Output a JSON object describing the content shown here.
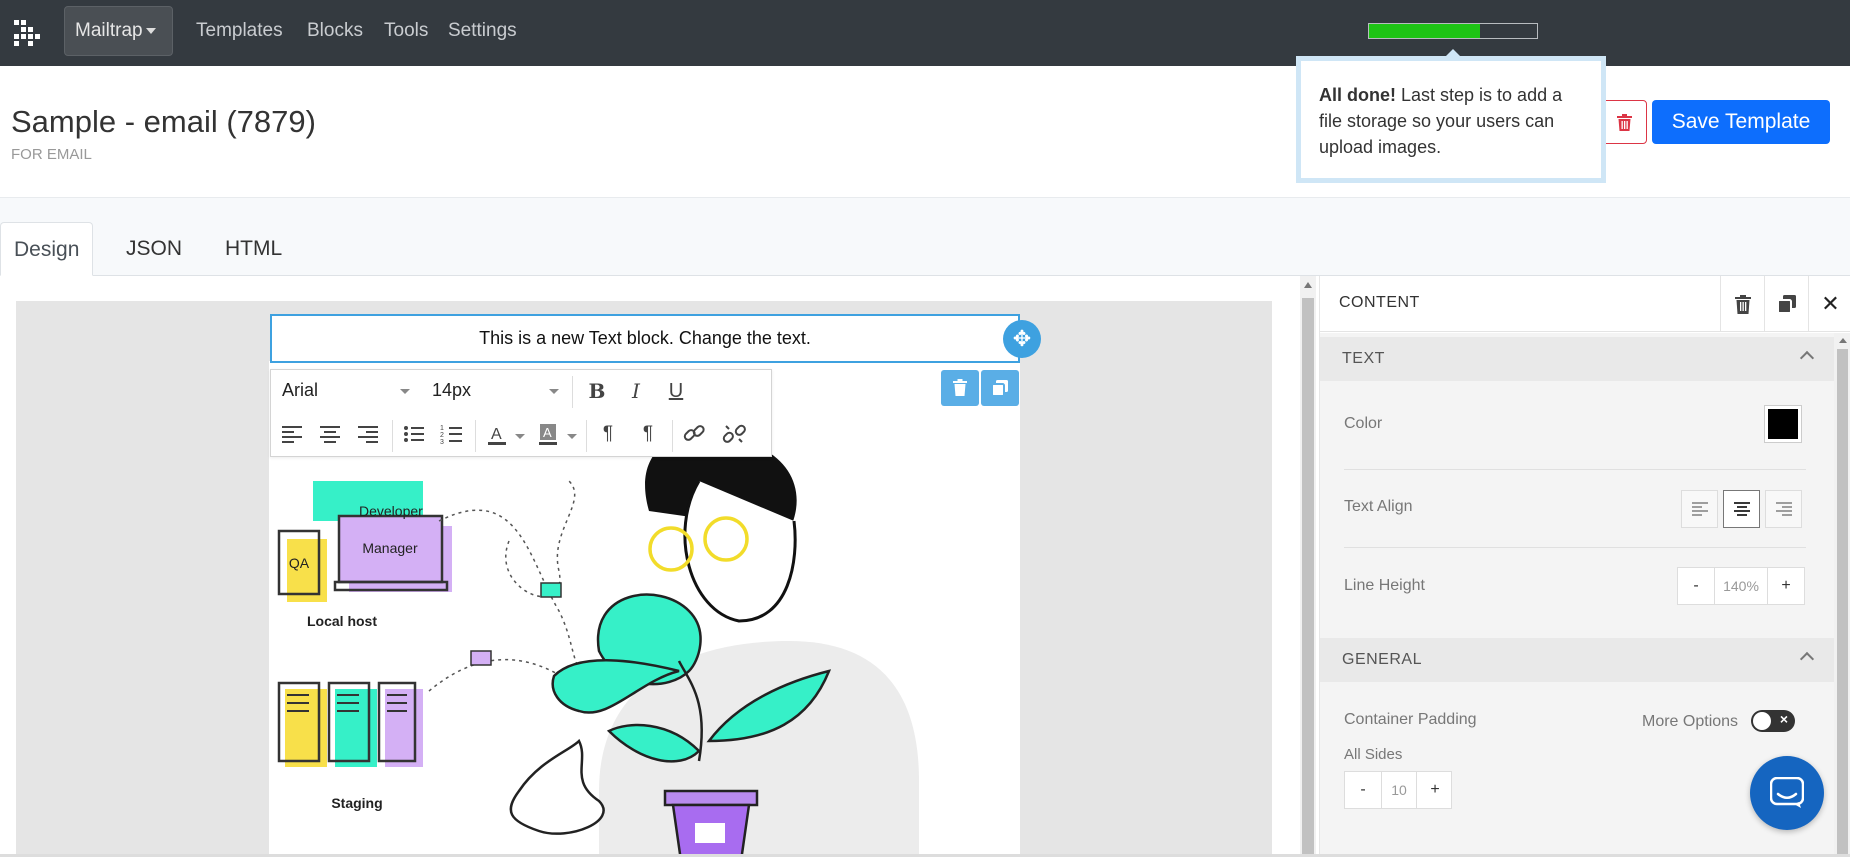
{
  "nav": {
    "brand": "Mailtrap",
    "links": [
      "Templates",
      "Blocks",
      "Tools",
      "Settings"
    ],
    "progress": 0.66
  },
  "header": {
    "title": "Sample - email (7879)",
    "subtitle": "FOR EMAIL",
    "save_label": "Save Template"
  },
  "popover": {
    "bold": "All done!",
    "text": " Last step is to add a file storage so your users can upload images."
  },
  "tabs": [
    "Design",
    "JSON",
    "HTML"
  ],
  "editor": {
    "text_block": "This is a new Text block. Change the text.",
    "font": "Arial",
    "font_size": "14px"
  },
  "illustration": {
    "labels": {
      "developer": "Developer",
      "qa": "QA",
      "manager": "Manager",
      "localhost": "Local host",
      "staging": "Staging"
    }
  },
  "panel": {
    "title": "CONTENT",
    "text_section": "TEXT",
    "color_label": "Color",
    "color_value": "#000000",
    "text_align_label": "Text Align",
    "text_align_value": "center",
    "line_height_label": "Line Height",
    "line_height_value": "140%",
    "general_section": "GENERAL",
    "container_padding_label": "Container Padding",
    "more_options_label": "More Options",
    "all_sides_label": "All Sides",
    "all_sides_value": "10"
  },
  "colors": {
    "nav_bg": "#343a40",
    "primary": "#0d6efd",
    "danger": "#dc3545",
    "selection": "#3ea1e0",
    "progress": "#1ec415",
    "mint": "#36f0c8",
    "lilac": "#d4b0f5",
    "yellow": "#f8e04a"
  }
}
